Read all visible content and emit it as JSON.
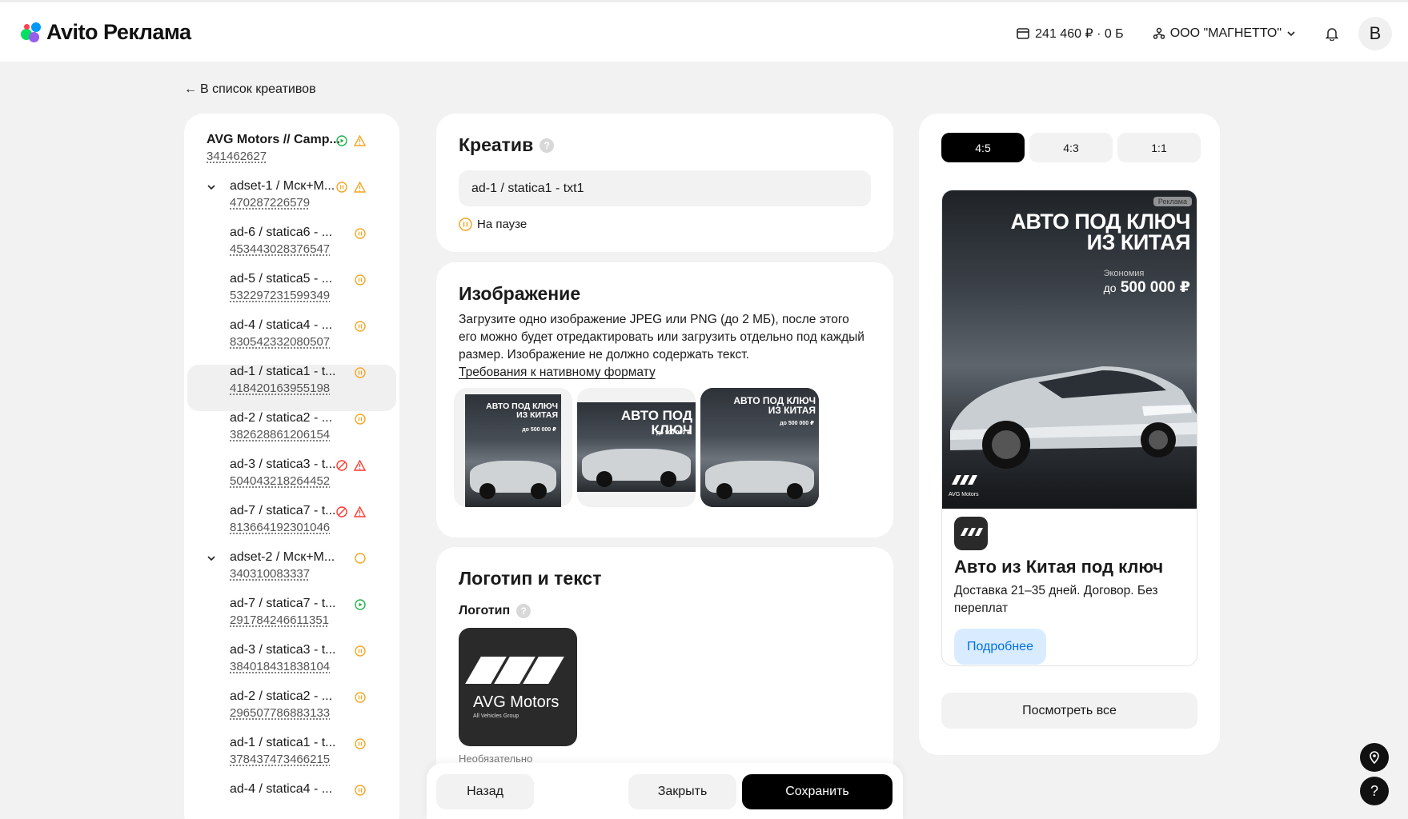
{
  "header": {
    "logo": "Avito Реклама",
    "balance": "241 460 ₽ · 0 Б",
    "company": "ООО \"МАГНЕТТО\"",
    "avatar_letter": "В"
  },
  "back_link": "В список креативов",
  "tree": [
    {
      "name": "AVG Motors // Camp...",
      "id": "341462627",
      "level": 0,
      "icons": [
        "play",
        "warn"
      ]
    },
    {
      "name": "adset-1 / Мск+М...",
      "id": "470287226579",
      "level": 1,
      "icons": [
        "pause",
        "warn"
      ]
    },
    {
      "name": "ad-6 / statica6 - ...",
      "id": "453443028376547",
      "level": 2,
      "icons": [
        "pause"
      ]
    },
    {
      "name": "ad-5 / statica5 - ...",
      "id": "532297231599349",
      "level": 2,
      "icons": [
        "pause"
      ]
    },
    {
      "name": "ad-4 / statica4 - ...",
      "id": "830542332080507",
      "level": 2,
      "icons": [
        "pause"
      ]
    },
    {
      "name": "ad-1 / statica1 - t...",
      "id": "418420163955198",
      "level": 2,
      "icons": [
        "pause"
      ],
      "selected": true
    },
    {
      "name": "ad-2 / statica2 - ...",
      "id": "382628861206154",
      "level": 2,
      "icons": [
        "pause"
      ]
    },
    {
      "name": "ad-3 / statica3 - t...",
      "id": "504043218264452",
      "level": 2,
      "icons": [
        "ban",
        "warn-red"
      ]
    },
    {
      "name": "ad-7 / statica7 - t...",
      "id": "813664192301046",
      "level": 2,
      "icons": [
        "ban",
        "warn-red"
      ]
    },
    {
      "name": "adset-2 / Мск+М...",
      "id": "340310083337",
      "level": 1,
      "icons": [
        "circle"
      ]
    },
    {
      "name": "ad-7 / statica7 - t...",
      "id": "291784246611351",
      "level": 2,
      "icons": [
        "play"
      ]
    },
    {
      "name": "ad-3 / statica3 - t...",
      "id": "384018431838104",
      "level": 2,
      "icons": [
        "pause"
      ]
    },
    {
      "name": "ad-2 / statica2 - ...",
      "id": "296507786883133",
      "level": 2,
      "icons": [
        "pause"
      ]
    },
    {
      "name": "ad-1 / statica1 - t...",
      "id": "378437473466215",
      "level": 2,
      "icons": [
        "pause"
      ]
    },
    {
      "name": "ad-4 / statica4 - ...",
      "id": "",
      "level": 2,
      "icons": [
        "pause"
      ]
    }
  ],
  "creative": {
    "title": "Креатив",
    "name_value": "ad-1 / statica1 - txt1",
    "status": "На паузе"
  },
  "image_section": {
    "title": "Изображение",
    "description": "Загрузите одно изображение JPEG или PNG (до 2 МБ), после этого его можно будет отредактировать или загрузить отдельно под каждый размер. Изображение не должно содержать текст.",
    "requirements_link": "Требования к нативному формату",
    "thumb_headline": "АВТО ПОД КЛЮЧ ИЗ КИТАЯ",
    "thumb_headline_short": "АВТО ПОД КЛЮЧ",
    "thumb_price": "до 500 000 ₽"
  },
  "logo_section": {
    "title": "Логотип и текст",
    "logo_label": "Логотип",
    "logo_name": "AVG Motors",
    "logo_sub": "All Vehicles Group",
    "optional": "Необязательно"
  },
  "actions": {
    "back": "Назад",
    "close": "Закрыть",
    "save": "Сохранить"
  },
  "preview": {
    "tabs": [
      "4:5",
      "4:3",
      "1:1"
    ],
    "active_tab": "4:5",
    "badge": "Реклама",
    "headline_line1": "АВТО ПОД КЛЮЧ",
    "headline_line2": "ИЗ КИТАЯ",
    "economy_label": "Экономия",
    "economy_prefix": "до",
    "economy_value": "500 000 ₽",
    "brand_mini": "AVG Motors",
    "ad_title": "Авто из Китая под ключ",
    "ad_desc": "Доставка 21–35 дней. Договор. Без переплат",
    "ad_button": "Подробнее",
    "see_all": "Посмотреть все"
  }
}
